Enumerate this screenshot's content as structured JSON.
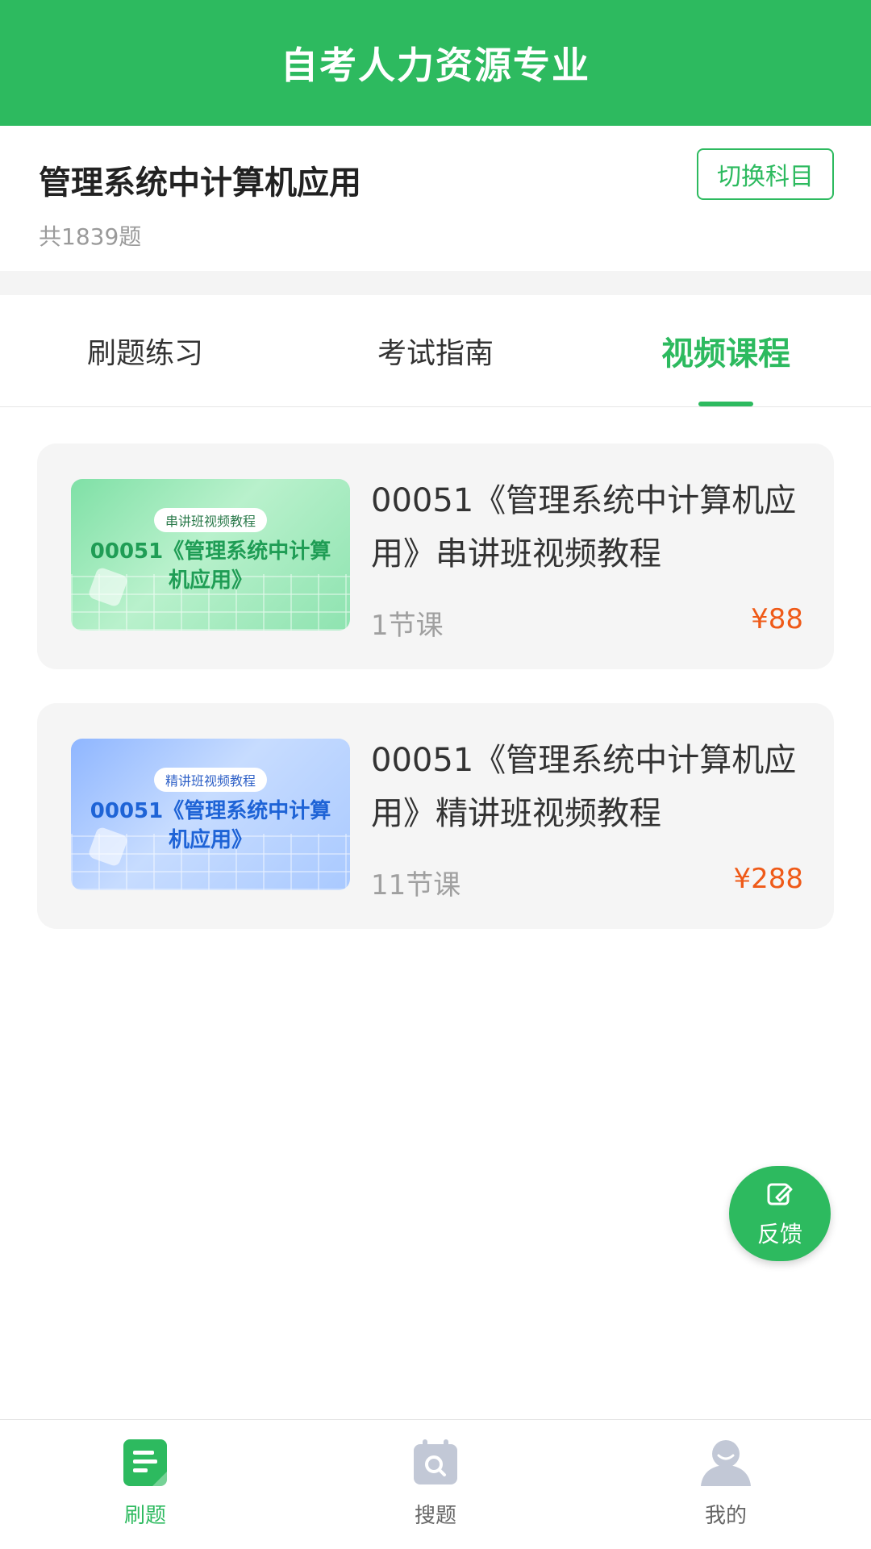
{
  "header": {
    "title": "自考人力资源专业"
  },
  "subject": {
    "name": "管理系统中计算机应用",
    "count": "共1839题",
    "switch_label": "切换科目"
  },
  "tabs": [
    {
      "label": "刷题练习",
      "active": false
    },
    {
      "label": "考试指南",
      "active": false
    },
    {
      "label": "视频课程",
      "active": true
    }
  ],
  "courses": [
    {
      "thumb_tag": "串讲班视频教程",
      "thumb_title_line1": "00051《管理系统中计算",
      "thumb_title_line2": "机应用》",
      "title": "00051《管理系统中计算机应用》串讲班视频教程",
      "lessons": "1节课",
      "price": "¥88"
    },
    {
      "thumb_tag": "精讲班视频教程",
      "thumb_title_line1": "00051《管理系统中计算",
      "thumb_title_line2": "机应用》",
      "title": "00051《管理系统中计算机应用》精讲班视频教程",
      "lessons": "11节课",
      "price": "¥288"
    }
  ],
  "fab": {
    "label": "反馈",
    "icon": "edit-note-icon"
  },
  "bottom_nav": [
    {
      "label": "刷题",
      "icon": "document-icon",
      "active": true
    },
    {
      "label": "搜题",
      "icon": "calendar-search-icon",
      "active": false
    },
    {
      "label": "我的",
      "icon": "user-icon",
      "active": false
    }
  ],
  "colors": {
    "accent": "#2dba5f",
    "price": "#ef5a18"
  }
}
